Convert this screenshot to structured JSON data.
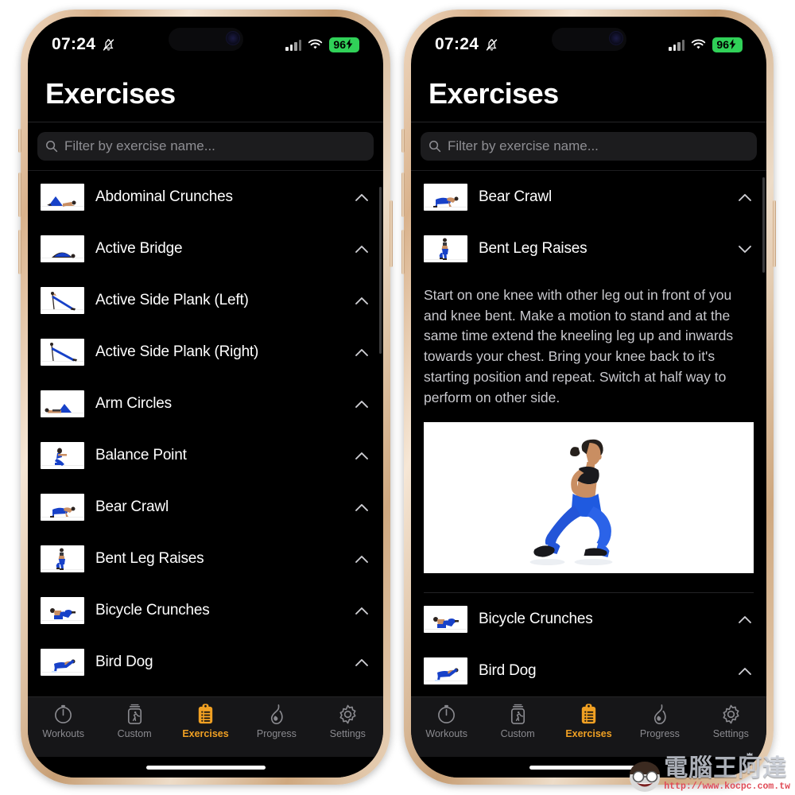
{
  "statusbar": {
    "time": "07:24",
    "mute_icon": "bell-slash-icon",
    "battery_percent": "96",
    "battery_color": "#30d158",
    "signal_icon": "cellular-bars-icon",
    "wifi_icon": "wifi-icon",
    "charging_icon": "bolt-icon"
  },
  "header": {
    "title": "Exercises"
  },
  "search": {
    "placeholder": "Filter by exercise name...",
    "icon": "search-icon",
    "value": ""
  },
  "left_phone": {
    "exercises": [
      {
        "name": "Abdominal Crunches",
        "chevron": "chevron-up-icon",
        "expanded": false,
        "pose": "lying-crunch"
      },
      {
        "name": "Active Bridge",
        "chevron": "chevron-up-icon",
        "expanded": false,
        "pose": "bridge"
      },
      {
        "name": "Active Side Plank (Left)",
        "chevron": "chevron-up-icon",
        "expanded": false,
        "pose": "side-plank-left"
      },
      {
        "name": "Active Side Plank (Right)",
        "chevron": "chevron-up-icon",
        "expanded": false,
        "pose": "side-plank-right"
      },
      {
        "name": "Arm Circles",
        "chevron": "chevron-up-icon",
        "expanded": false,
        "pose": "lying-arms"
      },
      {
        "name": "Balance Point",
        "chevron": "chevron-up-icon",
        "expanded": false,
        "pose": "balance-sit"
      },
      {
        "name": "Bear Crawl",
        "chevron": "chevron-up-icon",
        "expanded": false,
        "pose": "bear-crawl"
      },
      {
        "name": "Bent Leg Raises",
        "chevron": "chevron-up-icon",
        "expanded": false,
        "pose": "standing-leg"
      },
      {
        "name": "Bicycle Crunches",
        "chevron": "chevron-up-icon",
        "expanded": false,
        "pose": "bicycle"
      },
      {
        "name": "Bird Dog",
        "chevron": "chevron-up-icon",
        "expanded": false,
        "pose": "bird-dog"
      }
    ]
  },
  "right_phone": {
    "exercises": [
      {
        "name": "Bear Crawl",
        "chevron": "chevron-up-icon",
        "expanded": false,
        "pose": "bear-crawl"
      },
      {
        "name": "Bent Leg Raises",
        "chevron": "chevron-down-icon",
        "expanded": true,
        "pose": "standing-leg"
      },
      {
        "name": "Bicycle Crunches",
        "chevron": "chevron-up-icon",
        "expanded": false,
        "pose": "bicycle"
      },
      {
        "name": "Bird Dog",
        "chevron": "chevron-up-icon",
        "expanded": false,
        "pose": "bird-dog"
      }
    ],
    "expanded_detail": {
      "description": "Start on one knee with other leg out in front of you and knee bent.  Make a motion to stand and at the same time extend the kneeling leg up and inwards towards your chest.  Bring your knee back to it's starting position and repeat.  Switch at half way to perform on other side.",
      "image_alt": "woman-performing-bent-leg-raise-lunge"
    }
  },
  "tabbar": {
    "accent_color": "#f0a023",
    "inactive_color": "#8a8a8f",
    "tabs": [
      {
        "label": "Workouts",
        "icon": "stopwatch-icon",
        "active": false
      },
      {
        "label": "Custom",
        "icon": "canister-runner-icon",
        "active": false
      },
      {
        "label": "Exercises",
        "icon": "clipboard-list-icon",
        "active": true
      },
      {
        "label": "Progress",
        "icon": "flame-icon",
        "active": false
      },
      {
        "label": "Settings",
        "icon": "gear-icon",
        "active": false
      }
    ]
  },
  "watermark": {
    "brand": "電腦王阿達",
    "url": "http://www.kocpc.com.tw"
  }
}
